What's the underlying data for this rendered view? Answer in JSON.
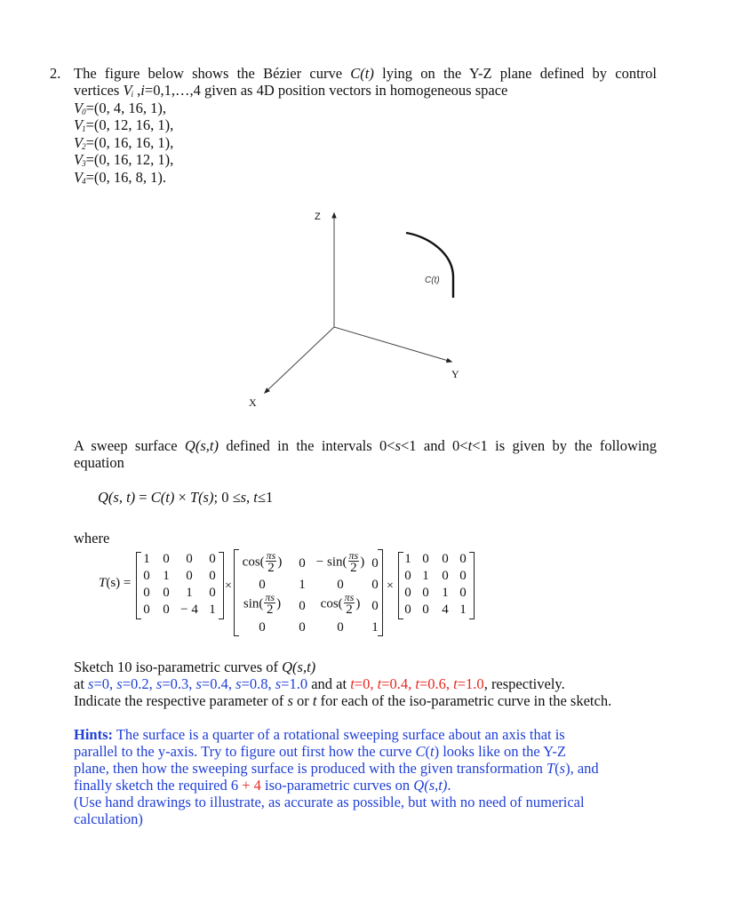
{
  "question": {
    "number": "2.",
    "intro_line1_a": "The figure below shows the Bézier curve ",
    "intro_line1_curve": "C(t)",
    "intro_line1_b": " lying on the Y-Z plane defined by control",
    "intro_line2_a": "vertices ",
    "intro_line2_vi": "V",
    "intro_line2_vi_sub": "i",
    "intro_line2_b": " ,",
    "intro_line2_i": "i",
    "intro_line2_c": "=0,1,…,4 given as 4D position vectors in homogeneous space",
    "vertices": [
      {
        "name": "V",
        "sub": "0",
        "value": "=(0, 4, 16, 1),"
      },
      {
        "name": "V",
        "sub": "1",
        "value": "=(0, 12, 16, 1),"
      },
      {
        "name": "V",
        "sub": "2",
        "value": "=(0, 16, 16, 1),"
      },
      {
        "name": "V",
        "sub": "3",
        "value": "=(0, 16, 12, 1),"
      },
      {
        "name": "V",
        "sub": "4",
        "value": "=(0, 16, 8, 1)."
      }
    ]
  },
  "figure": {
    "axis_z_label": "Z",
    "axis_y_label": "Y",
    "axis_x_label": "X",
    "curve_label": "C(t)"
  },
  "sweep": {
    "line1_a": "A sweep surface ",
    "line1_q": "Q(s,t)",
    "line1_b": " defined in the intervals 0<",
    "line1_s": "s",
    "line1_c": "<1 and 0<",
    "line1_t": "t",
    "line1_d": "<1 is given by the following",
    "line2": "equation",
    "equation": {
      "lhs": "Q(s, t)",
      "eq": " = ",
      "c": "C(t)",
      "times": " × ",
      "ts": "T(s)",
      "semi": ";  0 ≤",
      "s": "s",
      "comma": ", ",
      "t": "t",
      "end": "≤1"
    },
    "where": "where"
  },
  "transform": {
    "lhs_T": "T",
    "lhs_rest": "(s) =",
    "times_symbol": "×",
    "matrix1": [
      [
        "1",
        "0",
        "0",
        "0"
      ],
      [
        "0",
        "1",
        "0",
        "0"
      ],
      [
        "0",
        "0",
        "1",
        "0"
      ],
      [
        "0",
        "0",
        "− 4",
        "1"
      ]
    ],
    "matrix2": {
      "cos": "cos(",
      "sin": "sin(",
      "neg_sin": "− sin(",
      "close": ")",
      "frac_num": "πs",
      "frac_den": "2",
      "zero": "0",
      "one": "1"
    },
    "matrix3": [
      [
        "1",
        "0",
        "0",
        "0"
      ],
      [
        "0",
        "1",
        "0",
        "0"
      ],
      [
        "0",
        "0",
        "1",
        "0"
      ],
      [
        "0",
        "0",
        "4",
        "1"
      ]
    ]
  },
  "task": {
    "line1_a": "Sketch 10 iso-parametric curves of ",
    "line1_q": "Q(s,t)",
    "line2_at": "at ",
    "s_values": [
      "s=0",
      "s=0.2",
      "s=0.3",
      "s=0.4",
      "s=0.8",
      "s=1.0"
    ],
    "and_at": " and at ",
    "t_values": [
      "t=0",
      "t=0.4",
      "t=0.6",
      "t=1.0"
    ],
    "respectively": ", respectively.",
    "line3_a": "Indicate the respective parameter of ",
    "line3_s": "s",
    "line3_b": " or ",
    "line3_t": "t",
    "line3_c": " for each of the iso-parametric curve in the sketch.",
    "colors": {
      "s_color": "#1f3fd6",
      "t_color": "#e8271f"
    }
  },
  "hints": {
    "label": "Hints:",
    "line1": " The surface is a quarter of a rotational sweeping surface about an axis that is",
    "line2_a": "parallel to the y-axis. Try to figure out first how the curve ",
    "line2_c": "C",
    "line2_paren": "(",
    "line2_t": "t",
    "line2_close": ")",
    "line2_b": " looks like on the Y-Z",
    "line3_a": "plane, then how the sweeping surface is produced with the given transformation ",
    "line3_T": "T",
    "line3_p1": "(",
    "line3_s": "s",
    "line3_p2": ")",
    "line3_b": ", and",
    "line4_a": "finally sketch the required 6 ",
    "line4_plus": "+ 4",
    "line4_b": " iso-parametric curves on ",
    "line4_q": "Q(s,t)",
    "line4_end": ".",
    "line5": "(Use hand drawings to illustrate, as accurate as possible, but with no need of numerical",
    "line6": "calculation)"
  }
}
